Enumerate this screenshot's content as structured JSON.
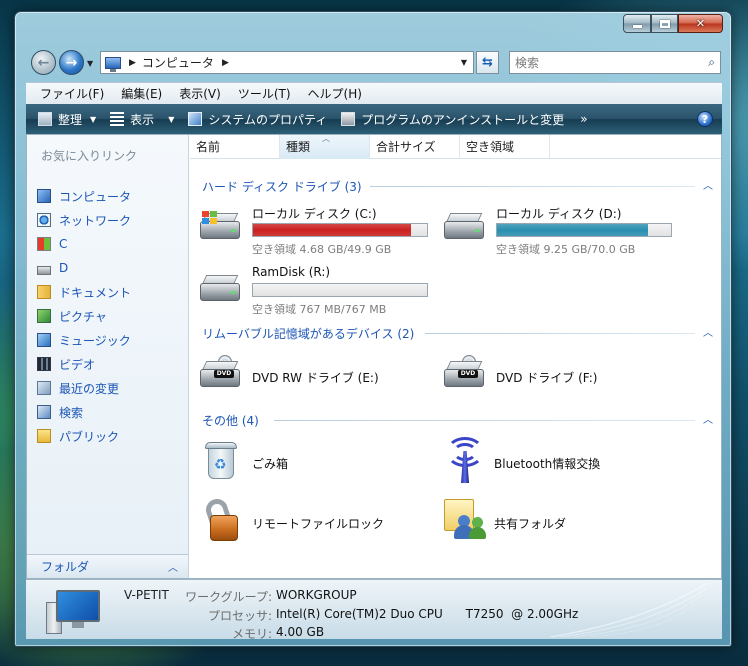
{
  "window": {
    "caption_buttons": {
      "minimize": "",
      "maximize": "",
      "close": "✕"
    }
  },
  "nav": {
    "breadcrumb": "コンピュータ",
    "search_placeholder": "検索"
  },
  "menu": [
    "ファイル(F)",
    "編集(E)",
    "表示(V)",
    "ツール(T)",
    "ヘルプ(H)"
  ],
  "commands": [
    {
      "label": "整理",
      "icon": "organize-icon",
      "dropdown": true
    },
    {
      "label": "表示",
      "icon": "views-icon",
      "dropdown": true
    },
    {
      "label": "システムのプロパティ",
      "icon": "system-properties-icon",
      "dropdown": false
    },
    {
      "label": "プログラムのアンインストールと変更",
      "icon": "uninstall-icon",
      "dropdown": false
    }
  ],
  "commands_more": "»",
  "sidebar": {
    "heading": "お気に入りリンク",
    "items": [
      {
        "label": "コンピュータ",
        "icon": "computer-icon"
      },
      {
        "label": "ネットワーク",
        "icon": "network-icon"
      },
      {
        "label": "C",
        "icon": "drive-c-icon"
      },
      {
        "label": "D",
        "icon": "drive-d-icon"
      },
      {
        "label": "ドキュメント",
        "icon": "documents-icon"
      },
      {
        "label": "ピクチャ",
        "icon": "pictures-icon"
      },
      {
        "label": "ミュージック",
        "icon": "music-icon"
      },
      {
        "label": "ビデオ",
        "icon": "videos-icon"
      },
      {
        "label": "最近の変更",
        "icon": "recent-changes-icon"
      },
      {
        "label": "検索",
        "icon": "searches-icon"
      },
      {
        "label": "パブリック",
        "icon": "public-folder-icon"
      }
    ],
    "folders_label": "フォルダ"
  },
  "columns": [
    "名前",
    "種類",
    "合計サイズ",
    "空き領域"
  ],
  "groups": {
    "hdd": {
      "title": "ハード ディスク ドライブ (3)",
      "drives": [
        {
          "name": "ローカル ディスク (C:)",
          "free": "空き領域 4.68 GB/49.9 GB",
          "used_fraction": 0.906,
          "bar_color": "#cc1f1f"
        },
        {
          "name": "ローカル ディスク (D:)",
          "free": "空き領域 9.25 GB/70.0 GB",
          "used_fraction": 0.868,
          "bar_color": "#2a8fb0"
        },
        {
          "name": "RamDisk (R:)",
          "free": "空き領域 767 MB/767 MB",
          "used_fraction": 0.0,
          "bar_color": "#2a8fb0"
        }
      ]
    },
    "removable": {
      "title": "リムーバブル記憶域があるデバイス (2)",
      "drives": [
        {
          "name": "DVD RW ドライブ (E:)"
        },
        {
          "name": "DVD ドライブ (F:)"
        }
      ]
    },
    "other": {
      "title": "その他 (4)",
      "items": [
        {
          "name": "ごみ箱",
          "icon": "recycle-bin-icon"
        },
        {
          "name": "Bluetooth情報交換",
          "icon": "bluetooth-icon"
        },
        {
          "name": "リモートファイルロック",
          "icon": "padlock-icon"
        },
        {
          "name": "共有フォルダ",
          "icon": "shared-folder-icon"
        }
      ]
    },
    "dvd_badge": "DVD"
  },
  "details": {
    "computer_name": "V-PETIT",
    "workgroup_label": "ワークグループ:",
    "workgroup_value": "WORKGROUP",
    "processor_label": "プロセッサ:",
    "processor_value": "Intel(R) Core(TM)2 Duo CPU      T7250  @ 2.00GHz",
    "memory_label": "メモリ:",
    "memory_value": "4.00 GB"
  }
}
